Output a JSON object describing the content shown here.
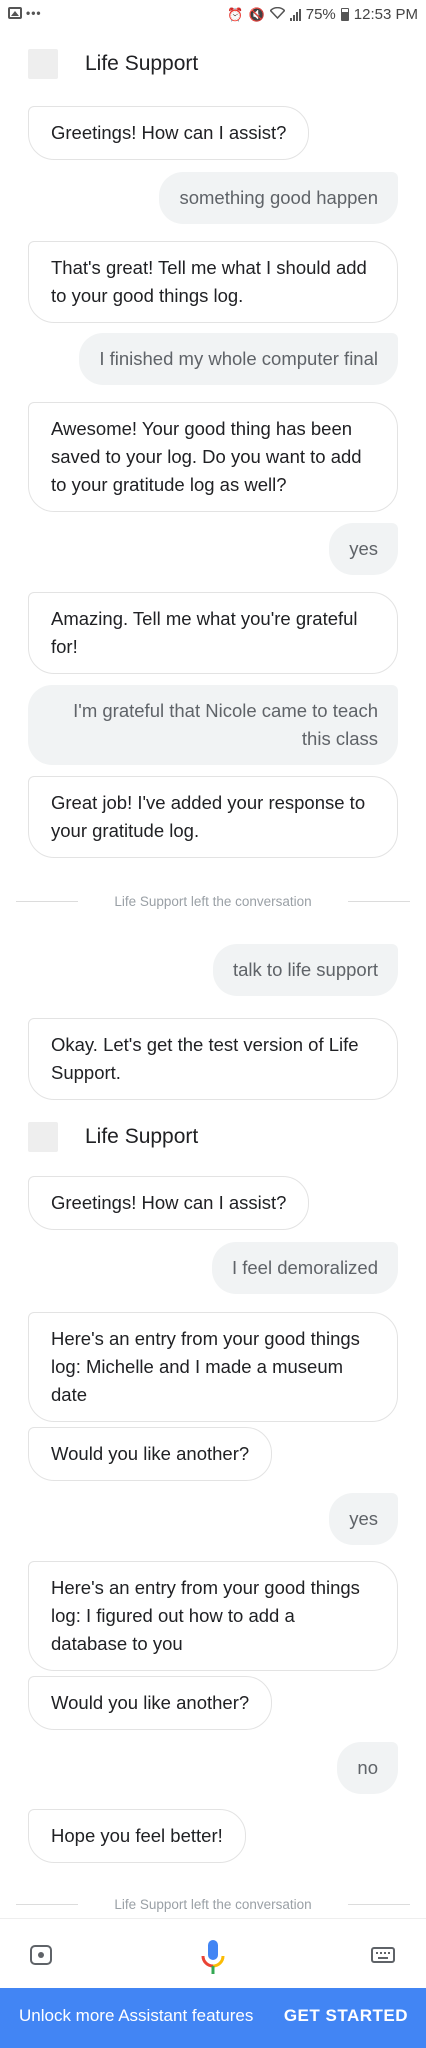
{
  "status_bar": {
    "icons_left": [
      "image-icon",
      "dots-icon"
    ],
    "icons_right": [
      "alarm-icon",
      "mute-icon",
      "wifi-icon",
      "signal-icon",
      "battery-icon"
    ],
    "battery": "75%",
    "time": "12:53 PM"
  },
  "header_1": {
    "title": "Life Support"
  },
  "header_2": {
    "title": "Life Support"
  },
  "messages": [
    {
      "from": "assistant",
      "text": "Greetings! How can I assist?"
    },
    {
      "from": "user",
      "text": "something good happen"
    },
    {
      "from": "assistant",
      "text": "That's great! Tell me what I should add to your good things log."
    },
    {
      "from": "user",
      "text": "I finished my whole computer final"
    },
    {
      "from": "assistant",
      "text": "Awesome! Your good thing has been saved to your log. Do you want to add to your gratitude log as well?"
    },
    {
      "from": "user",
      "text": "yes"
    },
    {
      "from": "assistant",
      "text": "Amazing. Tell me what you're grateful for!"
    },
    {
      "from": "user",
      "text": "I'm grateful that Nicole came to teach this class"
    },
    {
      "from": "assistant",
      "text": "Great job! I've added your response to your gratitude log."
    },
    {
      "from": "system",
      "text": "Life Support left the conversation"
    },
    {
      "from": "user",
      "text": "talk to life support"
    },
    {
      "from": "assistant",
      "text": "Okay. Let's get the test version of Life Support."
    },
    {
      "from": "assistant",
      "text": "Greetings! How can I assist?"
    },
    {
      "from": "user",
      "text": "I feel demoralized"
    },
    {
      "from": "assistant",
      "text": "Here's an entry from your good things log: Michelle and I made a museum date"
    },
    {
      "from": "assistant",
      "text": "Would you like another?"
    },
    {
      "from": "user",
      "text": "yes"
    },
    {
      "from": "assistant",
      "text": "Here's an entry from your good things log: I figured out how to add a database to you"
    },
    {
      "from": "assistant",
      "text": "Would you like another?"
    },
    {
      "from": "user",
      "text": "no"
    },
    {
      "from": "assistant",
      "text": "Hope you feel better!"
    },
    {
      "from": "system",
      "text": "Life Support left the conversation"
    }
  ],
  "toolbar": {
    "icons": [
      "lens-icon",
      "mic-icon",
      "keyboard-icon"
    ],
    "colors": {
      "mic_blue": "#4285f4",
      "mic_red": "#ea4335",
      "mic_yellow": "#fbbc05",
      "mic_green": "#34a853"
    }
  },
  "promo": {
    "text": "Unlock more Assistant features",
    "button": "GET STARTED",
    "color": "#4285f4"
  }
}
